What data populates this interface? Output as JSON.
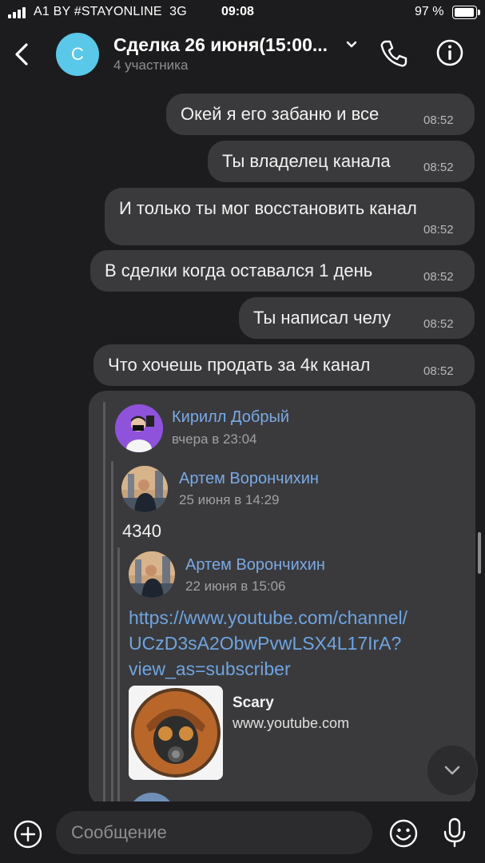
{
  "status_bar": {
    "carrier": "A1 BY #STAYONLINE",
    "network": "3G",
    "time": "09:08",
    "battery": "97 %"
  },
  "header": {
    "avatar_letter": "С",
    "title": "Сделка 26 июня(15:00...",
    "subtitle": "4 участника",
    "icons": [
      "back-chevron-icon",
      "chevron-down-icon",
      "phone-icon",
      "info-icon"
    ]
  },
  "messages": [
    {
      "text": "Окей я его забаню и все",
      "time": "08:52"
    },
    {
      "text": "Ты владелец канала",
      "time": "08:52"
    },
    {
      "text": "И только ты мог восстановить канал",
      "time": "08:52"
    },
    {
      "text": "В сделки когда оставался 1 день",
      "time": "08:52"
    },
    {
      "text": "Ты написал челу",
      "time": "08:52"
    },
    {
      "text": "Что хочешь продать за 4к канал",
      "time": "08:52"
    }
  ],
  "forward": {
    "level1": {
      "name": "Кирилл Добрый",
      "date": "вчера в 23:04"
    },
    "level2": {
      "name": "Артем Ворончихин",
      "date": "25 июня в 14:29",
      "text": "4340"
    },
    "level3": {
      "name": "Артем Ворончихин",
      "date": "22 июня в 15:06",
      "link_lines": [
        "https://www.youtube.com/channel/",
        "UCzD3sA2ObwPvwLSX4L17IrA?",
        "view_as=subscriber"
      ],
      "preview_title": "Scary",
      "preview_site": "www.youtube.com"
    }
  },
  "input": {
    "placeholder": "Сообщение"
  },
  "colors": {
    "background": "#1c1c1e",
    "bubble": "#3a3a3c",
    "link": "#6fa4e0",
    "name": "#7aa9e6",
    "avatar": "#5ac8e8"
  }
}
